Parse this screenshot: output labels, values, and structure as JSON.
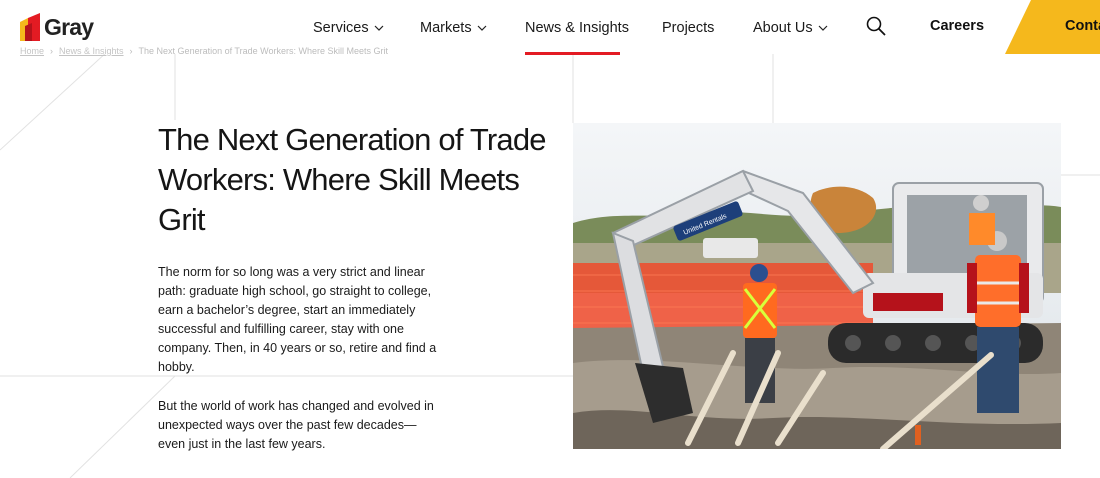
{
  "logo": {
    "text": "Gray",
    "colors": {
      "red": "#e31b23",
      "yellow": "#f5b81c"
    }
  },
  "nav": {
    "items": [
      {
        "label": "Services",
        "has_dropdown": true
      },
      {
        "label": "Markets",
        "has_dropdown": true
      },
      {
        "label": "News & Insights",
        "has_dropdown": false,
        "active": true
      },
      {
        "label": "Projects",
        "has_dropdown": false
      },
      {
        "label": "About Us",
        "has_dropdown": true
      }
    ],
    "search_icon": "search-icon",
    "careers_label": "Careers",
    "contact_label": "Conta",
    "accent_color": "#e31b23",
    "contact_color": "#f5b81c"
  },
  "breadcrumb": [
    "Home",
    "News & Insights",
    "The Next Generation of Trade Workers: Where Skill Meets Grit"
  ],
  "article": {
    "title": "The Next Generation of Trade Workers: Where Skill Meets Grit",
    "paragraphs": [
      "The norm for so long was a very strict and linear path: graduate high school, go straight to college, earn a bachelor’s degree, start an immediately successful and fulfilling career, stay with one company. Then, in 40 years or so, retire and find a hobby.",
      "But the world of work has changed and evolved in unexpected ways over the past few decades—even just in the last few years."
    ],
    "image_label": "United Rentals"
  }
}
